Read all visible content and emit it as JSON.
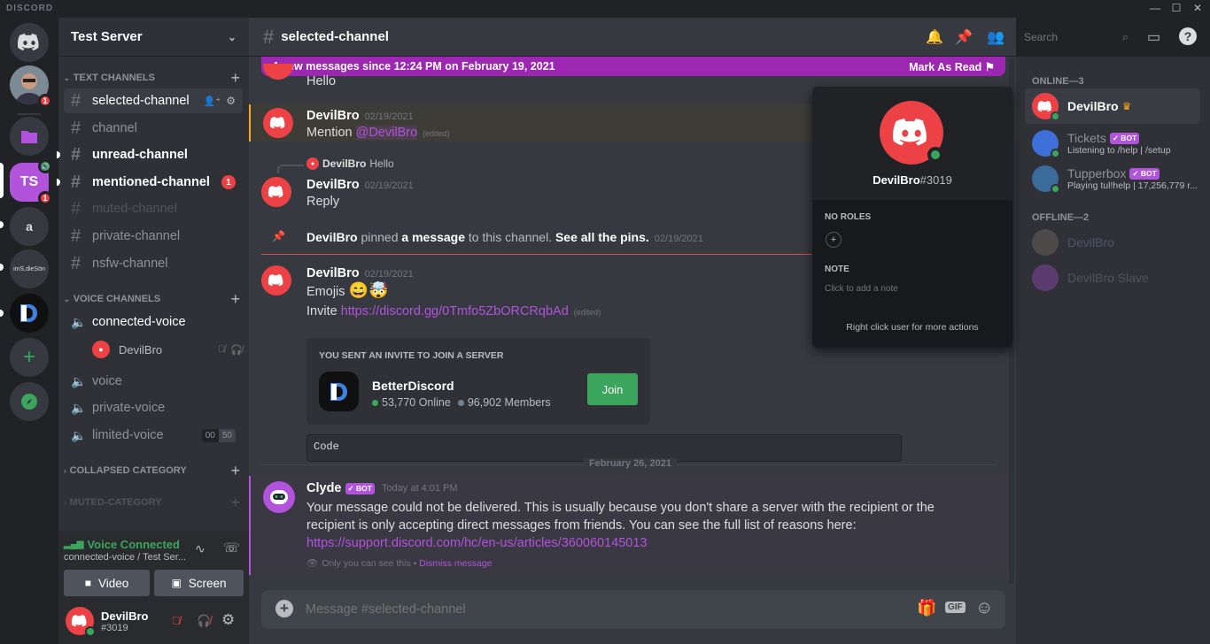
{
  "window": {
    "brand": "DISCORD",
    "min": "—",
    "max": "☐",
    "close": "✕"
  },
  "guilds": {
    "selected_initials": "TS",
    "user_initial": "a",
    "server_label": "imS,dieSön",
    "badge_1": "1",
    "badge_2": "1"
  },
  "server": {
    "name": "Test Server"
  },
  "categories": {
    "text": "TEXT CHANNELS",
    "voice": "VOICE CHANNELS",
    "collapsed": "COLLAPSED CATEGORY",
    "muted": "MUTED-CATEGORY"
  },
  "channels": {
    "selected": "selected-channel",
    "channel": "channel",
    "unread": "unread-channel",
    "mentioned": "mentioned-channel",
    "mention_count": "1",
    "muted": "muted-channel",
    "private": "private-channel",
    "nsfw": "nsfw-channel"
  },
  "voice": {
    "connected": "connected-voice",
    "voice_user": "DevilBro",
    "voice": "voice",
    "private": "private-voice",
    "limited": "limited-voice",
    "limit_count": "00",
    "limit_max": "50"
  },
  "voice_panel": {
    "status": "Voice Connected",
    "location": "connected-voice / Test Ser...",
    "video": "Video",
    "screen": "Screen"
  },
  "user": {
    "name": "DevilBro",
    "tag": "#3019"
  },
  "header": {
    "channel": "selected-channel",
    "search_placeholder": "Search"
  },
  "new_messages": {
    "text": "4 new messages since 12:24 PM on February 19, 2021",
    "action": "Mark As Read"
  },
  "messages": {
    "hello": "Hello",
    "m1": {
      "author": "DevilBro",
      "time": "02/19/2021",
      "text": "Mention ",
      "mention": "@DevilBro",
      "edited": "(edited)"
    },
    "m2": {
      "reply_author": "DevilBro",
      "reply_text": "Hello",
      "author": "DevilBro",
      "time": "02/19/2021",
      "text": "Reply"
    },
    "pin": {
      "author": "DevilBro",
      "t1": " pinned ",
      "t2": "a message",
      "t3": " to this channel. ",
      "t4": "See all the pins.",
      "time": "02/19/2021"
    },
    "m3": {
      "author": "DevilBro",
      "time": "02/19/2021",
      "text": "Emojis ",
      "emoji": "😄🤯",
      "invite_prefix": "Invite ",
      "invite_link": "https://discord.gg/0Tmfo5ZbORCRqbAd",
      "edited": "(edited)"
    },
    "invite": {
      "heading": "YOU SENT AN INVITE TO JOIN A SERVER",
      "server": "BetterDiscord",
      "online": "53,770 Online",
      "members": "96,902 Members",
      "join": "Join"
    },
    "code": "Code",
    "divider": "February 26, 2021",
    "clyde": {
      "author": "Clyde",
      "bot": "✓ BOT",
      "time": "Today at 4:01 PM",
      "text": "Your message could not be delivered. This is usually because you don't share a server with the recipient or the recipient is only accepting direct messages from friends. You can see the full list of reasons here: ",
      "link": "https://support.discord.com/hc/en-us/articles/360060145013",
      "only_you": "Only you can see this • ",
      "dismiss": "Dismiss message"
    }
  },
  "composer": {
    "placeholder": "Message #selected-channel",
    "gif": "GIF"
  },
  "popout": {
    "username": "DevilBro",
    "discrim": "#3019",
    "no_roles": "NO ROLES",
    "role_plus": "+",
    "note_label": "NOTE",
    "note_placeholder": "Click to add a note",
    "footer": "Right click user for more actions"
  },
  "member_list": {
    "online_header": "ONLINE—3",
    "offline_header": "OFFLINE—2",
    "online": [
      {
        "name": "DevilBro",
        "crown": "♛"
      },
      {
        "name": "Tickets",
        "bot": "✓ BOT",
        "status": "Listening to /help | /setup"
      },
      {
        "name": "Tupperbox",
        "bot": "✓ BOT",
        "status": "Playing tul!help | 17,256,779 r..."
      }
    ],
    "offline": [
      {
        "name": "DevilBro"
      },
      {
        "name": "DevilBro Slave"
      }
    ]
  },
  "colors": {
    "brand": "#ed4245",
    "accent": "#b153db",
    "online": "#3ba55d",
    "join": "#3ba55d"
  }
}
